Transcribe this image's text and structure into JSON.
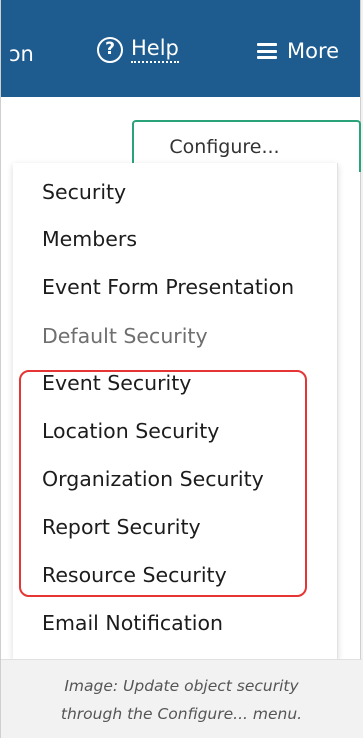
{
  "topbar": {
    "cut_label": "ɔn",
    "help_icon_glyph": "?",
    "help_label": "Help",
    "more_label": "More"
  },
  "configure_label": "Configure...",
  "menu": {
    "items": [
      {
        "label": "Security",
        "state": "enabled"
      },
      {
        "label": "Members",
        "state": "enabled"
      },
      {
        "label": "Event Form Presentation",
        "state": "enabled"
      },
      {
        "label": "Default Security",
        "state": "disabled"
      },
      {
        "label": "Event Security",
        "state": "enabled"
      },
      {
        "label": "Location Security",
        "state": "enabled"
      },
      {
        "label": "Organization Security",
        "state": "enabled"
      },
      {
        "label": "Report Security",
        "state": "enabled"
      },
      {
        "label": "Resource Security",
        "state": "enabled"
      },
      {
        "label": "Email Notification",
        "state": "enabled"
      }
    ]
  },
  "caption": {
    "line1": "Image: Update object security",
    "line2": "through the Configure... menu."
  },
  "colors": {
    "topbar": "#1e5b8e",
    "configure_border": "#2aa37a",
    "highlight_border": "#e53535"
  }
}
